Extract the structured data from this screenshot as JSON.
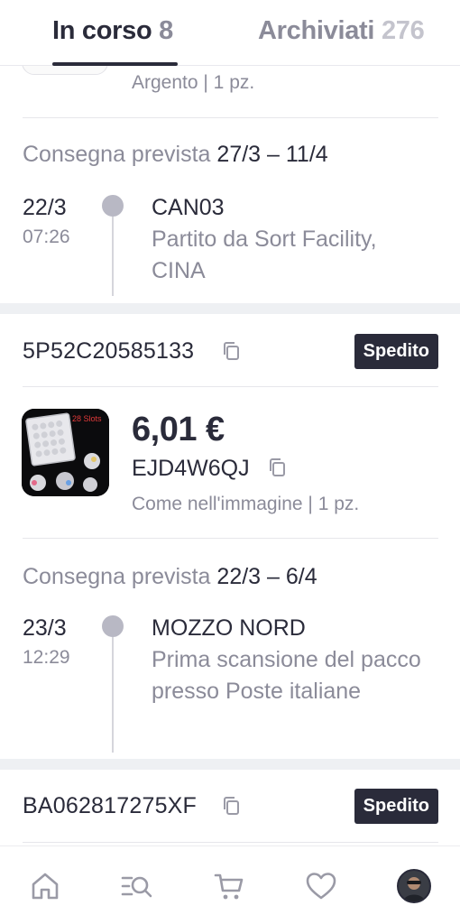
{
  "tabs": {
    "in_progress": {
      "label": "In corso",
      "count": "8"
    },
    "archived": {
      "label": "Archiviati",
      "count": "276"
    }
  },
  "previous_item": {
    "variant": "Argento | 1 pz.",
    "delivery_label": "Consegna prevista",
    "delivery_value": "27/3 – 11/4",
    "event": {
      "date": "22/3",
      "time": "07:26",
      "title": "CAN03",
      "description": "Partito da Sort Facility, CINA"
    }
  },
  "shipments": [
    {
      "tracking": "5P52C20585133",
      "status": "Spedito",
      "thumbnail_badge": "28 Slots",
      "price": "6,01 €",
      "order_code": "EJD4W6QJ",
      "variant": "Come nell'immagine | 1 pz.",
      "delivery_label": "Consegna prevista",
      "delivery_value": "22/3 – 6/4",
      "event": {
        "date": "23/3",
        "time": "12:29",
        "title": "MOZZO NORD",
        "description": "Prima scansione del pacco presso Poste italiane"
      }
    },
    {
      "tracking": "BA062817275XF",
      "status": "Spedito"
    }
  ],
  "bottom_nav": {
    "items": [
      "home-icon",
      "search-list-icon",
      "cart-icon",
      "heart-icon",
      "profile-avatar"
    ]
  },
  "colors": {
    "text": "#2a2b3a",
    "muted": "#8b8b99",
    "badge_bg": "#2a2b3a",
    "timeline_dot": "#b8b8c4",
    "separator": "#eef0f3"
  }
}
